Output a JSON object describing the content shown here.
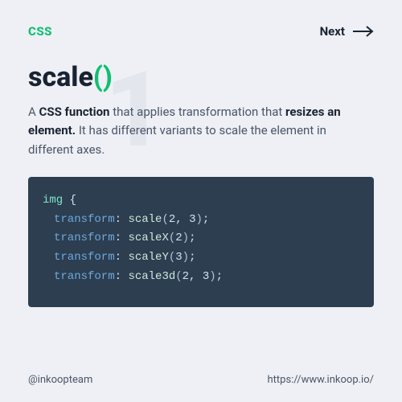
{
  "header": {
    "badge": "CSS",
    "next": "Next"
  },
  "watermark": "1",
  "title": {
    "name": "scale",
    "parens": "()"
  },
  "description": {
    "p1": "A",
    "b1": "CSS function",
    "p2": "that applies transformation that",
    "b2": "resizes an element.",
    "p3": "It has different variants to scale the element in different axes."
  },
  "code": {
    "selector": "img",
    "lines": [
      {
        "prop": "transform",
        "fn": "scale",
        "args": "2, 3"
      },
      {
        "prop": "transform",
        "fn": "scaleX",
        "args": "2"
      },
      {
        "prop": "transform",
        "fn": "scaleY",
        "args": "3"
      },
      {
        "prop": "transform",
        "fn": "scale3d",
        "args": "2, 3"
      }
    ]
  },
  "footer": {
    "handle": "@inkoopteam",
    "url": "https://www.inkoop.io/"
  }
}
